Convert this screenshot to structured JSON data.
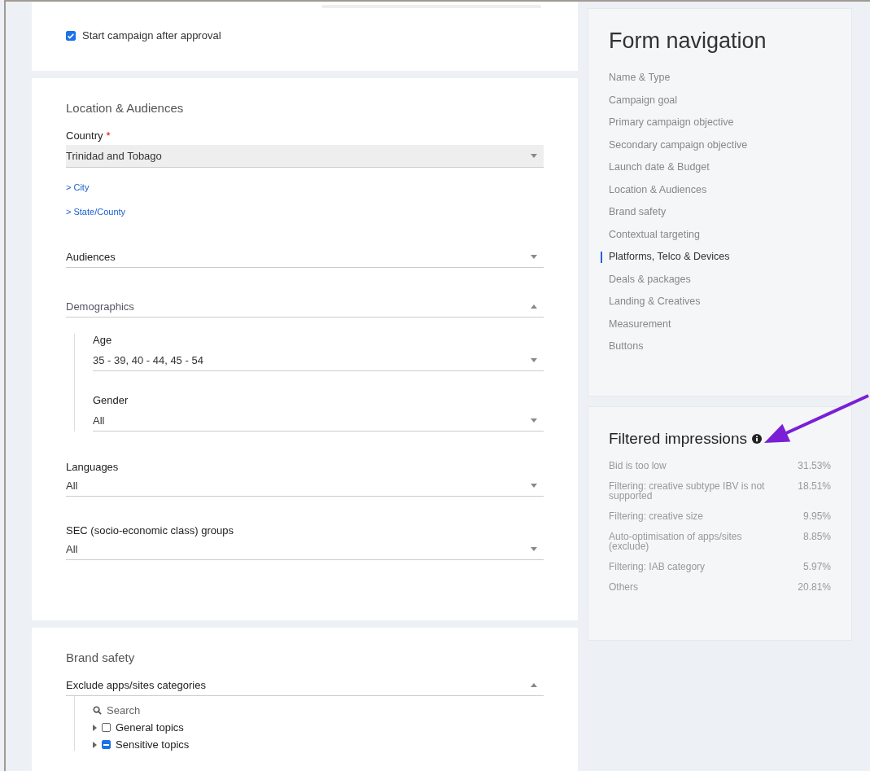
{
  "campaign_card": {
    "start_after_approval": {
      "label": "Start campaign after approval",
      "checked": true
    }
  },
  "location_section": {
    "title": "Location & Audiences",
    "country": {
      "label": "Country",
      "required_mark": "*",
      "value": "Trinidad and Tobago"
    },
    "links": [
      "> City",
      "> State/County"
    ],
    "audiences": {
      "label": "Audiences",
      "expanded": false
    },
    "demographics": {
      "label": "Demographics",
      "expanded": true,
      "fields": [
        {
          "label": "Age",
          "value": "35 - 39, 40 - 44, 45 - 54"
        },
        {
          "label": "Gender",
          "value": "All"
        }
      ]
    },
    "fields": [
      {
        "label": "Languages",
        "value": "All"
      },
      {
        "label": "SEC (socio-economic class) groups",
        "value": "All"
      }
    ]
  },
  "brand_safety": {
    "title": "Brand safety",
    "exclude": {
      "label": "Exclude apps/sites categories",
      "expanded": true
    },
    "search": {
      "placeholder": "Search"
    },
    "topics": [
      {
        "label": "General topics",
        "partial": false
      },
      {
        "label": "Sensitive topics",
        "partial": true
      }
    ]
  },
  "form_navigation": {
    "title": "Form navigation",
    "items": [
      {
        "label": "Name & Type",
        "selected": false
      },
      {
        "label": "Campaign goal",
        "selected": false
      },
      {
        "label": "Primary campaign objective",
        "selected": false
      },
      {
        "label": "Secondary campaign objective",
        "selected": false
      },
      {
        "label": "Launch date & Budget",
        "selected": false
      },
      {
        "label": "Location & Audiences",
        "selected": false
      },
      {
        "label": "Brand safety",
        "selected": false
      },
      {
        "label": "Contextual targeting",
        "selected": false
      },
      {
        "label": "Platforms, Telco & Devices",
        "selected": true
      },
      {
        "label": "Deals & packages",
        "selected": false
      },
      {
        "label": "Landing & Creatives",
        "selected": false
      },
      {
        "label": "Measurement",
        "selected": false
      },
      {
        "label": "Buttons",
        "selected": false
      }
    ]
  },
  "filtered_impressions": {
    "title": "Filtered impressions",
    "rows": [
      {
        "reason": "Bid is too low",
        "share": "31.53%"
      },
      {
        "reason": "Filtering: creative subtype IBV is not supported",
        "share": "18.51%"
      },
      {
        "reason": "Filtering: creative size",
        "share": "9.95%"
      },
      {
        "reason": "Auto-optimisation of apps/sites (exclude)",
        "share": "8.85%"
      },
      {
        "reason": "Filtering: IAB category",
        "share": "5.97%"
      },
      {
        "reason": "Others",
        "share": "20.81%"
      }
    ]
  }
}
